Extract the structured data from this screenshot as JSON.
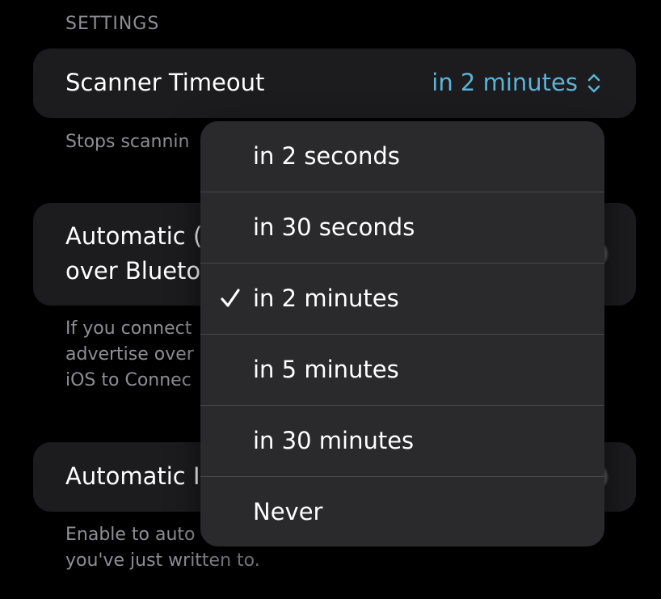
{
  "section": {
    "header": "SETTINGS"
  },
  "scanner_timeout": {
    "label": "Scanner Timeout",
    "value": "in 2 minutes",
    "footer": "Stops scannin"
  },
  "bluetooth_row": {
    "label_line1": "Automatic (",
    "label_line2": "over Blueto",
    "footer": "If you connect\nadvertise over\niOS to Connec"
  },
  "automatic_row": {
    "label": "Automatic I",
    "footer": "Enable to auto\nyou've just written to."
  },
  "menu": {
    "selected_index": 2,
    "items": [
      {
        "label": "in 2 seconds"
      },
      {
        "label": "in 30 seconds"
      },
      {
        "label": "in 2 minutes",
        "checked": true
      },
      {
        "label": "in 5 minutes"
      },
      {
        "label": "in 30 minutes"
      },
      {
        "label": "Never"
      }
    ]
  },
  "colors": {
    "accent": "#5ab4d9",
    "background": "#000000",
    "card": "#1c1c1e",
    "menu": "#2a2a2c",
    "secondary_text": "#8e8e93"
  }
}
